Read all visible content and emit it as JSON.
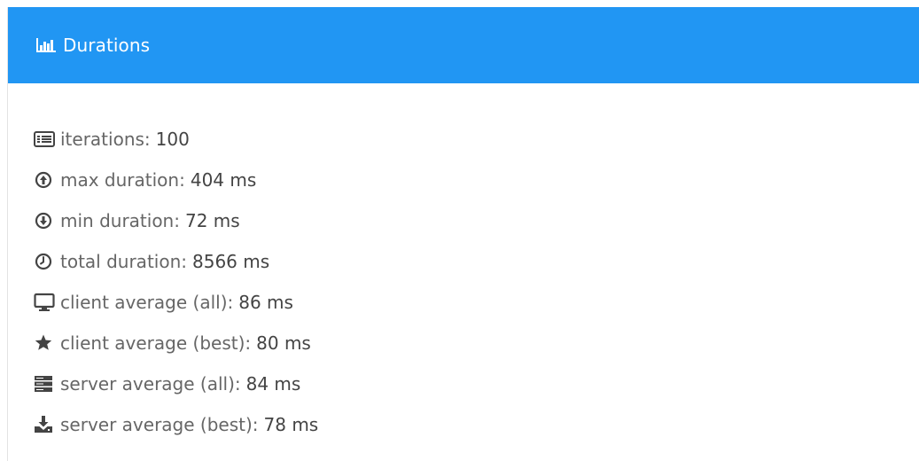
{
  "panel": {
    "title": "Durations",
    "header_icon": "bar-chart-icon",
    "header_color": "#2196f3"
  },
  "stats": [
    {
      "icon": "list-icon",
      "label": "iterations:",
      "value": "100"
    },
    {
      "icon": "arrow-circle-up-icon",
      "label": "max duration:",
      "value": "404 ms"
    },
    {
      "icon": "arrow-circle-down-icon",
      "label": "min duration:",
      "value": "72 ms"
    },
    {
      "icon": "clock-icon",
      "label": "total duration:",
      "value": "8566 ms"
    },
    {
      "icon": "monitor-icon",
      "label": "client average (all):",
      "value": "86 ms"
    },
    {
      "icon": "star-icon",
      "label": "client average (best):",
      "value": "80 ms"
    },
    {
      "icon": "server-icon",
      "label": "server average (all):",
      "value": "84 ms"
    },
    {
      "icon": "download-icon",
      "label": "server average (best):",
      "value": "78 ms"
    }
  ]
}
